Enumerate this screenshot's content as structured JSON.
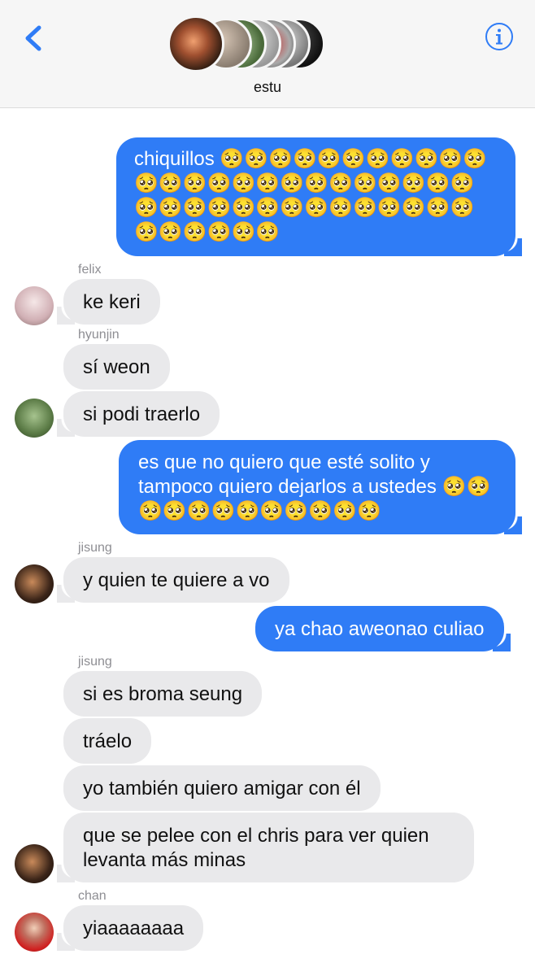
{
  "header": {
    "group_name": "estu",
    "back_icon": "chevron-left-icon",
    "info_icon": "info-icon",
    "accent": "#2f7cf6"
  },
  "messages": [
    {
      "direction": "out",
      "text": "chiquillos 🥺🥺🥺🥺🥺🥺🥺🥺🥺🥺🥺🥺🥺🥺🥺🥺🥺🥺🥺🥺🥺🥺🥺🥺🥺🥺🥺🥺🥺🥺🥺🥺🥺🥺🥺🥺🥺🥺🥺🥺🥺🥺🥺🥺🥺"
    },
    {
      "direction": "in",
      "sender": "felix",
      "text": "ke keri"
    },
    {
      "direction": "in",
      "sender": "hyunjin",
      "text": "sí weon"
    },
    {
      "direction": "in",
      "text": "si podi traerlo"
    },
    {
      "direction": "out",
      "text": "es que no quiero que esté solito y tampoco quiero dejarlos a ustedes 🥺🥺🥺🥺🥺🥺🥺🥺🥺🥺🥺🥺"
    },
    {
      "direction": "in",
      "sender": "jisung",
      "text": "y quien te quiere a vo"
    },
    {
      "direction": "out",
      "text": "ya chao aweonao culiao"
    },
    {
      "direction": "in",
      "sender": "jisung",
      "text": "si es broma seung"
    },
    {
      "direction": "in",
      "text": "tráelo"
    },
    {
      "direction": "in",
      "text": "yo también quiero amigar con él"
    },
    {
      "direction": "in",
      "text": "que se pelee con el chris para ver quien levanta más minas"
    },
    {
      "direction": "in",
      "sender": "chan",
      "text": "yiaaaaaaaa"
    }
  ],
  "colors": {
    "outgoing_bubble": "#2f7cf6",
    "incoming_bubble": "#e9e9eb",
    "sender_label": "#8e8e93"
  }
}
